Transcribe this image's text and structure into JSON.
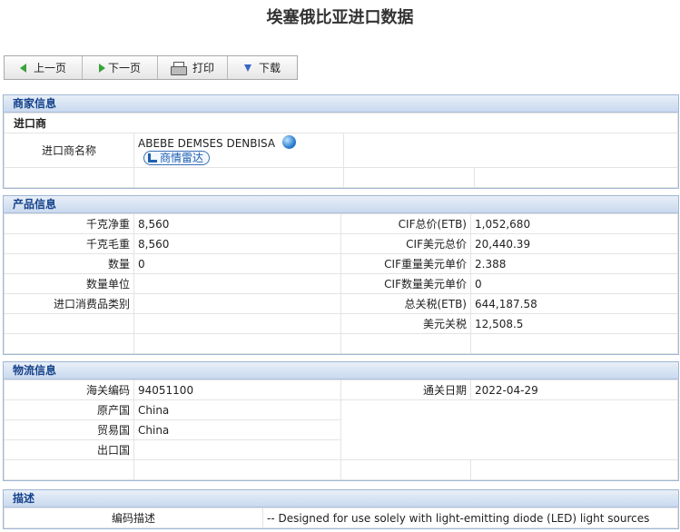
{
  "page": {
    "title": "埃塞俄比亚进口数据"
  },
  "toolbar": {
    "prev_label": "上一页",
    "next_label": "下一页",
    "print_label": "打印",
    "download_label": "下载"
  },
  "merchant": {
    "section_title": "商家信息",
    "importer_header": "进口商",
    "importer_name_label": "进口商名称",
    "importer_name": "ABEBE DEMSES DENBISA",
    "radar_label": "商情雷达"
  },
  "product": {
    "section_title": "产品信息",
    "net_weight_label": "千克净重",
    "net_weight": "8,560",
    "gross_weight_label": "千克毛重",
    "gross_weight": "8,560",
    "quantity_label": "数量",
    "quantity": "0",
    "quantity_unit_label": "数量单位",
    "quantity_unit": "",
    "category_label": "进口消费品类别",
    "category": "",
    "cif_total_label": "CIF总价(ETB)",
    "cif_total": "1,052,680",
    "cif_usd_label": "CIF美元总价",
    "cif_usd": "20,440.39",
    "cif_weight_unit_label": "CIF重量美元单价",
    "cif_weight_unit": "2.388",
    "cif_qty_unit_label": "CIF数量美元单价",
    "cif_qty_unit": "0",
    "total_tax_label": "总关税(ETB)",
    "total_tax": "644,187.58",
    "usd_tax_label": "美元关税",
    "usd_tax": "12,508.5"
  },
  "logistics": {
    "section_title": "物流信息",
    "hs_code_label": "海关编码",
    "hs_code": "94051100",
    "clear_date_label": "通关日期",
    "clear_date": "2022-04-29",
    "origin_label": "原产国",
    "origin": "China",
    "trade_country_label": "贸易国",
    "trade_country": "China",
    "export_country_label": "出口国",
    "export_country": ""
  },
  "description": {
    "section_title": "描述",
    "code_desc_label": "编码描述",
    "code_desc": "-- Designed for use solely with light-emitting diode (LED) light sources"
  },
  "colors": {
    "panel_header_text": "#15428b",
    "panel_border": "#9fb6d4",
    "accent_green": "#38a33a",
    "accent_blue": "#3a66c4"
  }
}
